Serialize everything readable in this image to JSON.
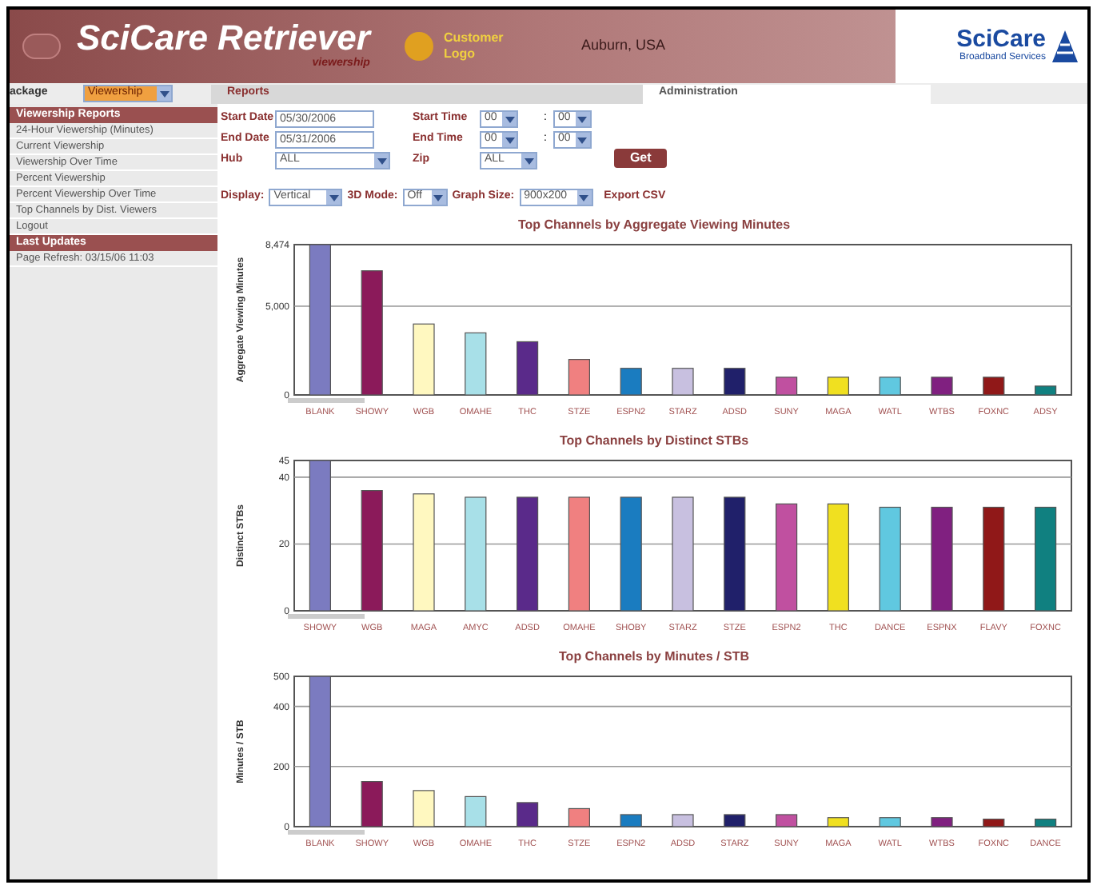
{
  "header": {
    "title": "SciCare Retriever",
    "subtitle": "viewership",
    "customer_logo": "Customer Logo",
    "location": "Auburn, USA",
    "brand": "SciCare",
    "brand_tagline": "Broadband Services"
  },
  "package": {
    "label": "ackage",
    "value": "Viewership"
  },
  "tabs": [
    {
      "label": "Reports",
      "selected": true
    },
    {
      "label": "Administration",
      "selected": false
    }
  ],
  "sidebar": {
    "sections": [
      {
        "title": "Viewership Reports",
        "items": [
          "24-Hour Viewership (Minutes)",
          "Current Viewership",
          "Viewership Over Time",
          "Percent Viewership",
          "Percent Viewership Over Time",
          "Top Channels by Dist. Viewers",
          "Logout"
        ]
      },
      {
        "title": "Last Updates",
        "items": [
          "Page Refresh:  03/15/06 11:03"
        ]
      }
    ]
  },
  "form": {
    "start_date": {
      "label": "Start Date",
      "value": "05/30/2006"
    },
    "end_date": {
      "label": "End Date",
      "value": "05/31/2006"
    },
    "hub": {
      "label": "Hub",
      "value": "ALL"
    },
    "start_time": {
      "label": "Start Time",
      "hour": "00",
      "minute": "00"
    },
    "end_time": {
      "label": "End Time",
      "hour": "00",
      "minute": "00"
    },
    "zip": {
      "label": "Zip",
      "value": "ALL"
    },
    "time_separator": ":",
    "get_button": "Get",
    "display": {
      "label": "Display:",
      "value": "Vertical"
    },
    "mode_3d": {
      "label": "3D Mode:",
      "value": "Off"
    },
    "graph_size": {
      "label": "Graph Size:",
      "value": "900x200"
    },
    "export": "Export CSV"
  },
  "charts": [
    {
      "chart_data": {
        "type": "bar",
        "title": "Top Channels by Aggregate Viewing Minutes",
        "ylabel": "Aggregate Viewing Minutes",
        "categories": [
          "BLANK",
          "SHOWY",
          "WGB",
          "OMAHE",
          "THC",
          "STZE",
          "ESPN2",
          "STARZ",
          "ADSD",
          "SUNY",
          "MAGA",
          "WATL",
          "WTBS",
          "FOXNC",
          "ADSY"
        ],
        "values": [
          8474,
          7000,
          4000,
          3500,
          3000,
          2000,
          1500,
          1500,
          1500,
          1000,
          1000,
          1000,
          1000,
          1000,
          500
        ],
        "ylim": [
          0,
          8474
        ],
        "yticks": [
          0,
          {
            "value": 5000,
            "label": "5,000"
          },
          {
            "value": 8474,
            "label": "8,474"
          }
        ]
      }
    },
    {
      "chart_data": {
        "type": "bar",
        "title": "Top Channels by Distinct STBs",
        "ylabel": "Distinct STBs",
        "categories": [
          "SHOWY",
          "WGB",
          "MAGA",
          "AMYC",
          "ADSD",
          "OMAHE",
          "SHOBY",
          "STARZ",
          "STZE",
          "ESPN2",
          "THC",
          "DANCE",
          "ESPNX",
          "FLAVY",
          "FOXNC"
        ],
        "values": [
          45,
          36,
          35,
          34,
          34,
          34,
          34,
          34,
          34,
          32,
          32,
          31,
          31,
          31,
          31
        ],
        "ylim": [
          0,
          45
        ],
        "yticks": [
          0,
          20,
          40,
          45
        ]
      }
    },
    {
      "chart_data": {
        "type": "bar",
        "title": "Top Channels by Minutes / STB",
        "ylabel": "Minutes / STB",
        "categories": [
          "BLANK",
          "SHOWY",
          "WGB",
          "OMAHE",
          "THC",
          "STZE",
          "ESPN2",
          "ADSD",
          "STARZ",
          "SUNY",
          "MAGA",
          "WATL",
          "WTBS",
          "FOXNC",
          "DANCE"
        ],
        "values": [
          500,
          150,
          120,
          100,
          80,
          60,
          40,
          40,
          40,
          40,
          30,
          30,
          30,
          25,
          25
        ],
        "ylim": [
          0,
          500
        ],
        "yticks": [
          0,
          200,
          400,
          500
        ]
      }
    }
  ]
}
